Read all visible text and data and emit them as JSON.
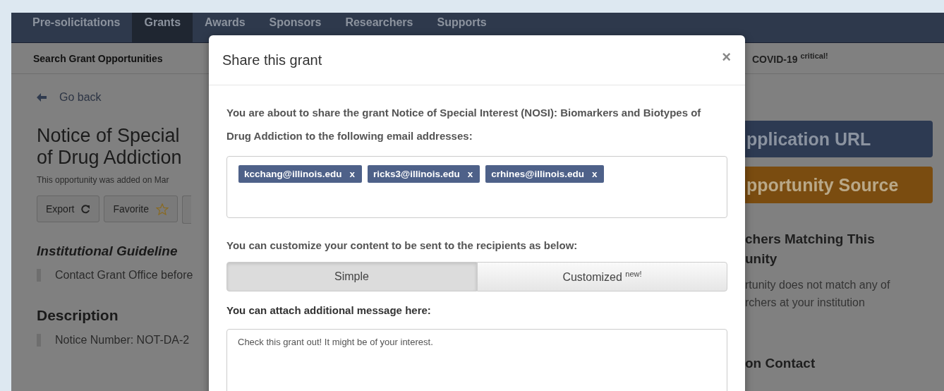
{
  "nav": {
    "tabs": [
      {
        "label": "Pre-solicitations",
        "selected": false
      },
      {
        "label": "Grants",
        "selected": true
      },
      {
        "label": "Awards",
        "selected": false
      },
      {
        "label": "Sponsors",
        "selected": false
      },
      {
        "label": "Researchers",
        "selected": false
      },
      {
        "label": "Supports",
        "selected": false
      }
    ]
  },
  "subnav": {
    "items": [
      "Search Grant Opportunities",
      "COVID-19 $^{critical!}$"
    ]
  },
  "page": {
    "back_link": "Go back",
    "title_lines": [
      "Notice of Special",
      "of Drug Addiction"
    ],
    "added_note": "This opportunity was added on Mar",
    "actions": [
      {
        "label": "Export",
        "kind": "export"
      },
      {
        "label": "Favorite",
        "kind": "favorite"
      }
    ],
    "guidelines": {
      "heading": "Institutional Guideline",
      "text": "Contact Grant Office before"
    },
    "description": {
      "heading": "Description",
      "text": "Notice Number: NOT-DA-2"
    }
  },
  "sidebar": {
    "links": [
      {
        "label": "pplication URL",
        "kind": "primary"
      },
      {
        "label": "pportunity Source",
        "kind": "source"
      }
    ],
    "researchers_heading": [
      "chers Matching This",
      "unity"
    ],
    "researchers_text": [
      "rtunity does not match any of",
      "rchers at your institution"
    ],
    "contact_heading": "on Contact"
  },
  "modal": {
    "title": "Share this grant",
    "close": "×",
    "intro": "You are about to share the grant **Notice of Special Interest (NOSI): Biomarkers and Biotypes of Drug Addiction** to the following email addresses:",
    "recipients": [
      {
        "email": "kcchang@illinois.edu",
        "remove": "x"
      },
      {
        "email": "ricks3@illinois.edu",
        "remove": "x"
      },
      {
        "email": "crhines@illinois.edu",
        "remove": "x"
      }
    ],
    "customize_label": "You can customize your content to be sent to the recipients as below:",
    "modes": [
      {
        "label": "Simple",
        "selected": true
      },
      {
        "label": "Customized $^{new!}$",
        "selected": false
      }
    ],
    "message_label": "You can attach additional message here:",
    "message": "Check this grant out! It might be of your interest."
  }
}
